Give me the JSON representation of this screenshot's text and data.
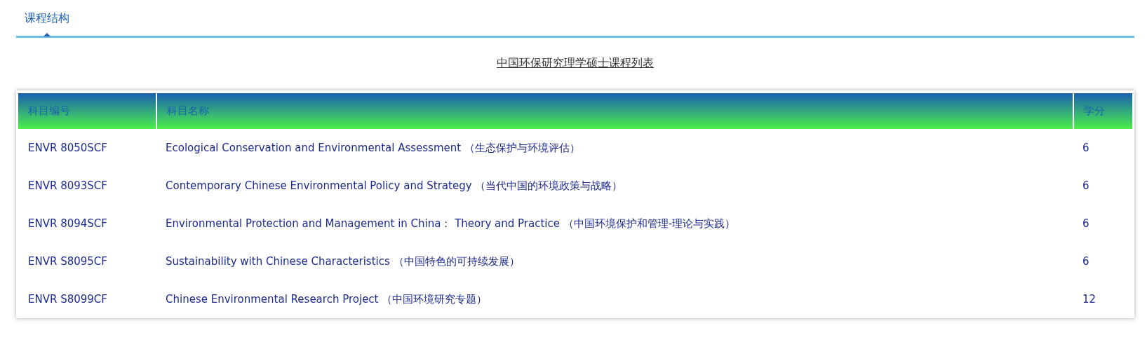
{
  "tabs": [
    {
      "label": "课程结构",
      "selected": true
    }
  ],
  "table": {
    "title": "中国环保研究理学硕士课程列表",
    "columns": [
      "科目编号",
      "科目名称",
      "学分"
    ],
    "rows": [
      [
        "ENVR 8050SCF",
        "Ecological Conservation and Environmental Assessment （生态保护与环境评估）",
        "6"
      ],
      [
        "ENVR 8093SCF",
        "Contemporary Chinese Environmental Policy and Strategy （当代中国的环境政策与战略）",
        "6"
      ],
      [
        "ENVR 8094SCF",
        "Environmental Protection and Management in China： Theory and Practice （中国环境保护和管理-理论与实践）",
        "6"
      ],
      [
        "ENVR S8095CF",
        "Sustainability with Chinese Characteristics （中国特色的可持续发展）",
        "6"
      ],
      [
        "ENVR S8099CF",
        "Chinese Environmental Research Project （中国环境研究专题）",
        "12"
      ]
    ]
  }
}
